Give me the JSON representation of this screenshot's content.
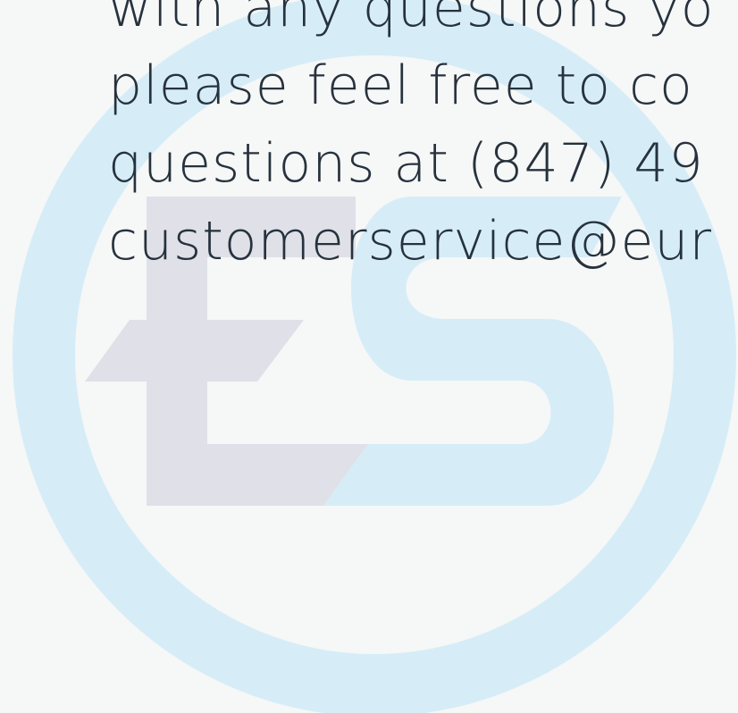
{
  "logo": {
    "name": "ES",
    "ring_color": "#d6edf7",
    "letter_e_color": "#dfe0e8",
    "letter_s_color": "#d6edf7"
  },
  "message": {
    "lines": [
      "with any questions yo",
      "please feel free to co",
      "questions at (847) 49",
      "customerservice@eur"
    ]
  },
  "colors": {
    "background": "#f6f7f7",
    "text": "#26323d"
  }
}
